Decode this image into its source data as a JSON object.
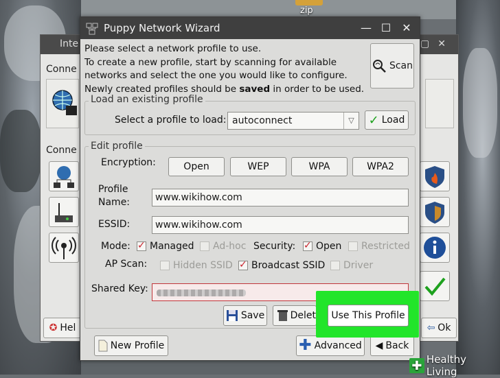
{
  "desktop": {
    "zip_label": "zip"
  },
  "bg_window": {
    "title": "Inte",
    "connect_label_1": "Conne",
    "connect_label_2": "Conne",
    "help_label": "Hel",
    "ok_label": "Ok"
  },
  "wizard": {
    "title": "Puppy Network Wizard",
    "intro_line1": "Please select a network profile to use.",
    "intro_line2": "To create a new profile, start by scanning for available",
    "intro_line3": "networks and select the one you would like to configure.",
    "intro_line4a": "Newly created profiles should be ",
    "intro_line4b": "saved",
    "intro_line4c": " in order to be used.",
    "scan_label": "Scan",
    "load_group": {
      "title": "Load an existing profile",
      "select_label": "Select a profile to load:",
      "profile_value": "autoconnect",
      "load_label": "Load"
    },
    "edit_group": {
      "title": "Edit profile",
      "encryption_label": "Encryption:",
      "encryption_options": [
        "Open",
        "WEP",
        "WPA",
        "WPA2"
      ],
      "profile_name_label_1": "Profile",
      "profile_name_label_2": "Name:",
      "profile_name_value": "www.wikihow.com",
      "essid_label": "ESSID:",
      "essid_value": "www.wikihow.com",
      "mode_label": "Mode:",
      "mode_managed": "Managed",
      "mode_adhoc": "Ad-hoc",
      "security_label": "Security:",
      "security_open": "Open",
      "security_restricted": "Restricted",
      "ap_scan_label": "AP Scan:",
      "ap_hidden": "Hidden SSID",
      "ap_broadcast": "Broadcast SSID",
      "ap_driver": "Driver",
      "shared_key_label": "Shared Key:",
      "save_label": "Save",
      "delete_label": "Delet",
      "use_profile_label": "Use This Profile"
    },
    "new_profile_label": "New Profile",
    "advanced_label": "Advanced",
    "back_label": "Back"
  },
  "watermark": {
    "text": "Healthy Living"
  },
  "colors": {
    "highlight": "#22e52a",
    "check": "#c8232c",
    "titlebar": "#3f3f3f"
  }
}
